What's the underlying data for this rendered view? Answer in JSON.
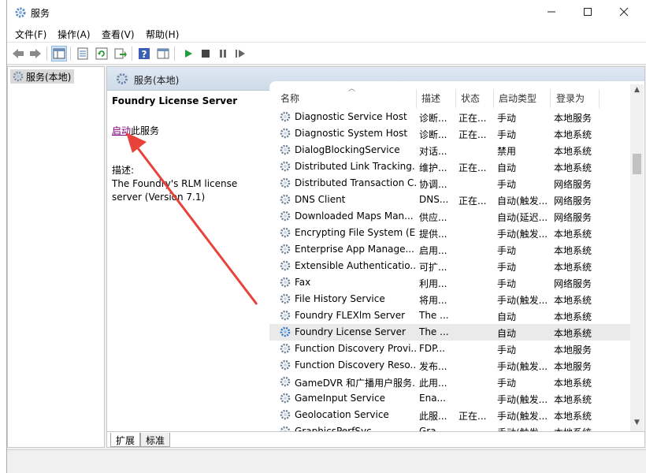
{
  "window": {
    "title": "服务"
  },
  "menu": [
    "文件(F)",
    "操作(A)",
    "查看(V)",
    "帮助(H)"
  ],
  "tree": {
    "root_label": "服务(本地)"
  },
  "panel": {
    "header": "服务(本地)"
  },
  "detail": {
    "service_name": "Foundry License Server",
    "start_link": "启动",
    "start_suffix": "此服务",
    "desc_label": "描述:",
    "desc_text": "The Foundry's RLM license server (Version 7.1)"
  },
  "columns": [
    "名称",
    "描述",
    "状态",
    "启动类型",
    "登录为"
  ],
  "rows": [
    {
      "name": "Diagnostic Service Host",
      "desc": "诊断...",
      "status": "正在...",
      "startup": "手动",
      "logon": "本地服务"
    },
    {
      "name": "Diagnostic System Host",
      "desc": "诊断...",
      "status": "正在...",
      "startup": "手动",
      "logon": "本地系统"
    },
    {
      "name": "DialogBlockingService",
      "desc": "对话...",
      "status": "",
      "startup": "禁用",
      "logon": "本地系统"
    },
    {
      "name": "Distributed Link Tracking...",
      "desc": "维护...",
      "status": "正在...",
      "startup": "自动",
      "logon": "本地系统"
    },
    {
      "name": "Distributed Transaction C...",
      "desc": "协调...",
      "status": "",
      "startup": "手动",
      "logon": "网络服务"
    },
    {
      "name": "DNS Client",
      "desc": "DNS...",
      "status": "正在...",
      "startup": "自动(触发...",
      "logon": "网络服务"
    },
    {
      "name": "Downloaded Maps Man...",
      "desc": "供应...",
      "status": "",
      "startup": "自动(延迟...",
      "logon": "网络服务"
    },
    {
      "name": "Encrypting File System (E...",
      "desc": "提供...",
      "status": "",
      "startup": "手动(触发...",
      "logon": "本地系统"
    },
    {
      "name": "Enterprise App Manage...",
      "desc": "启用...",
      "status": "",
      "startup": "手动",
      "logon": "本地系统"
    },
    {
      "name": "Extensible Authenticatio...",
      "desc": "可扩...",
      "status": "",
      "startup": "手动",
      "logon": "本地系统"
    },
    {
      "name": "Fax",
      "desc": "利用...",
      "status": "",
      "startup": "手动",
      "logon": "网络服务"
    },
    {
      "name": "File History Service",
      "desc": "将用...",
      "status": "",
      "startup": "手动(触发...",
      "logon": "本地系统"
    },
    {
      "name": "Foundry FLEXlm Server",
      "desc": "The ...",
      "status": "",
      "startup": "自动",
      "logon": "本地系统"
    },
    {
      "name": "Foundry License Server",
      "desc": "The ...",
      "status": "",
      "startup": "自动",
      "logon": "本地系统",
      "selected": true
    },
    {
      "name": "Function Discovery Provi...",
      "desc": "FDP...",
      "status": "",
      "startup": "手动",
      "logon": "本地服务"
    },
    {
      "name": "Function Discovery Reso...",
      "desc": "发布...",
      "status": "",
      "startup": "手动(触发...",
      "logon": "本地服务"
    },
    {
      "name": "GameDVR 和广播用户服务...",
      "desc": "此用...",
      "status": "",
      "startup": "手动",
      "logon": "本地系统"
    },
    {
      "name": "GameInput Service",
      "desc": "Ena...",
      "status": "",
      "startup": "手动(触发...",
      "logon": "本地系统"
    },
    {
      "name": "Geolocation Service",
      "desc": "此服...",
      "status": "正在...",
      "startup": "手动(触发...",
      "logon": "本地系统"
    },
    {
      "name": "GraphicsPerfSvc",
      "desc": "Gra...",
      "status": "",
      "startup": "手动(触发...",
      "logon": "本地系统"
    }
  ],
  "tabs": [
    "扩展",
    "标准"
  ],
  "colors": {
    "header_blue": "#cfdbe9",
    "link_purple": "#800080",
    "arrow_red": "#e8433a",
    "run_green": "#1a9e3a"
  }
}
